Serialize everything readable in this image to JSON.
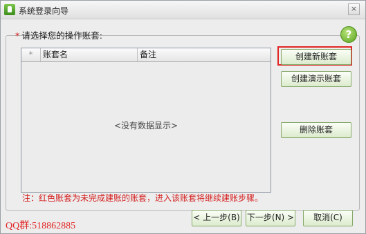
{
  "window": {
    "title": "系统登录向导",
    "close_glyph": "×"
  },
  "prompt": {
    "required_mark": "*",
    "label": "请选择您的操作账套:"
  },
  "help": {
    "icon": "help-icon",
    "glyph": "?"
  },
  "grid": {
    "columns": [
      "*",
      "账套名",
      "备注"
    ],
    "rows": [],
    "empty_text": "<没有数据显示>"
  },
  "actions": {
    "create": "创建新账套",
    "demo": "创建演示账套",
    "delete": "删除账套"
  },
  "note": "注：红色账套为未完成建账的账套，进入该账套将继续建账步骤。",
  "watermark": "QQ群:518862885",
  "nav": {
    "prev": "< 上一步(B)",
    "next": "下一步(N) >",
    "cancel": "取消(C)"
  },
  "colors": {
    "note_red": "#d41c1c",
    "highlight": "#e02424",
    "button_green": "#dcebcd"
  }
}
